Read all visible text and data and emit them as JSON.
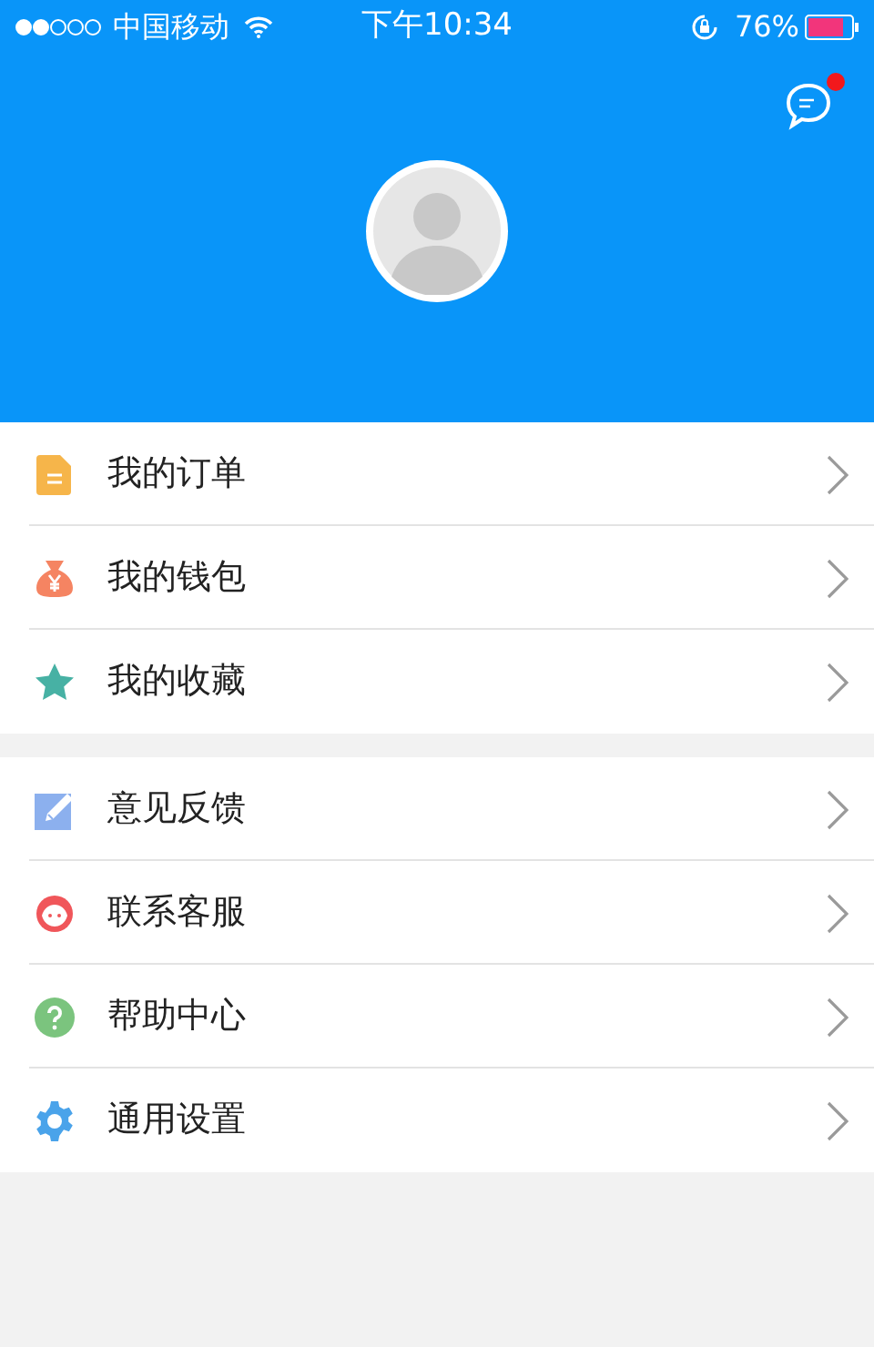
{
  "status_bar": {
    "carrier": "中国移动",
    "time": "下午10:34",
    "battery": "76%"
  },
  "header": {
    "messages_unread": true
  },
  "menu_groups": [
    [
      {
        "label": "我的订单"
      },
      {
        "label": "我的钱包"
      },
      {
        "label": "我的收藏"
      }
    ],
    [
      {
        "label": "意见反馈"
      },
      {
        "label": "联系客服"
      },
      {
        "label": "帮助中心"
      },
      {
        "label": "通用设置"
      }
    ]
  ]
}
